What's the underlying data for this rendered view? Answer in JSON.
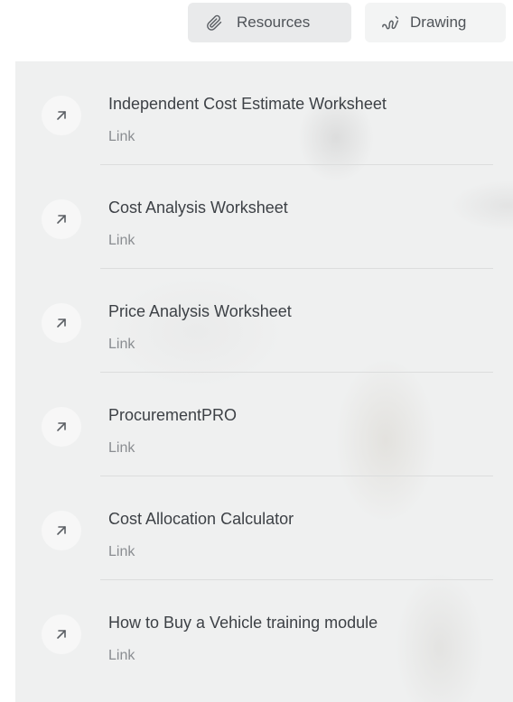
{
  "toolbar": {
    "resources_label": "Resources",
    "resources_icon": "paperclip-icon",
    "drawing_label": "Drawing",
    "drawing_icon": "squiggle-icon"
  },
  "resources": {
    "items": [
      {
        "title": "Independent Cost Estimate Worksheet",
        "type": "Link",
        "icon": "arrow-up-right-icon"
      },
      {
        "title": "Cost Analysis Worksheet",
        "type": "Link",
        "icon": "arrow-up-right-icon"
      },
      {
        "title": "Price Analysis Worksheet",
        "type": "Link",
        "icon": "arrow-up-right-icon"
      },
      {
        "title": "ProcurementPRO",
        "type": "Link",
        "icon": "arrow-up-right-icon"
      },
      {
        "title": "Cost Allocation Calculator",
        "type": "Link",
        "icon": "arrow-up-right-icon"
      },
      {
        "title": "How to Buy a Vehicle training module",
        "type": "Link",
        "icon": "arrow-up-right-icon"
      }
    ]
  },
  "colors": {
    "panel_bg": "#eff0f0",
    "active_tab_bg": "#e9eaeb",
    "text_primary": "#3d4146",
    "text_secondary": "#8a8d91"
  }
}
